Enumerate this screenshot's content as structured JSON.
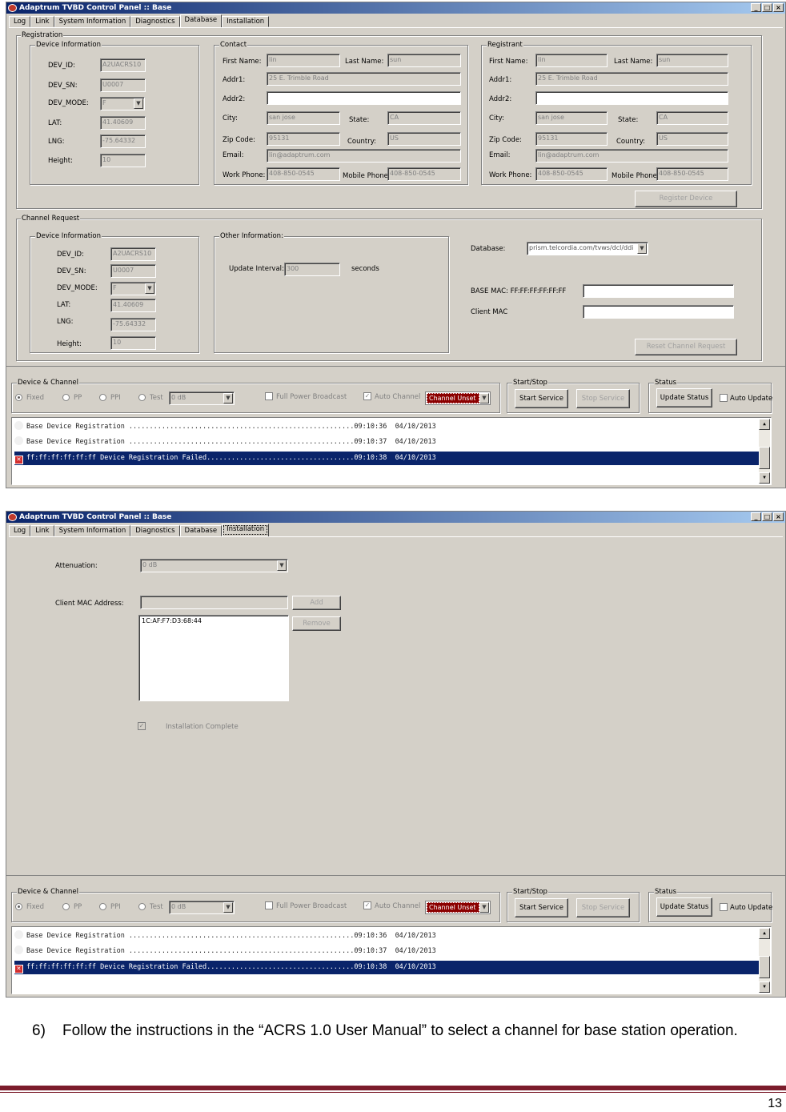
{
  "window1": {
    "title": "Adaptrum TVBD Control Panel :: Base",
    "tabs": [
      "Log",
      "Link",
      "System Information",
      "Diagnostics",
      "Database",
      "Installation"
    ],
    "active_tab": "Database"
  },
  "window2": {
    "title": "Adaptrum TVBD Control Panel :: Base",
    "tabs": [
      "Log",
      "Link",
      "System Information",
      "Diagnostics",
      "Database",
      "Installation"
    ],
    "active_tab": "Installation"
  },
  "registration": {
    "legend": "Registration",
    "device_info": {
      "legend": "Device Information",
      "dev_id_label": "DEV_ID:",
      "dev_id": "A2UACRS10",
      "dev_sn_label": "DEV_SN:",
      "dev_sn": "U0007",
      "dev_mode_label": "DEV_MODE:",
      "dev_mode": "F",
      "lat_label": "LAT:",
      "lat": "41.40609",
      "lng_label": "LNG:",
      "lng": "-75.64332",
      "height_label": "Height:",
      "height": "10"
    },
    "contact": {
      "legend": "Contact",
      "first_name_label": "First Name:",
      "first_name": "lin",
      "last_name_label": "Last Name:",
      "last_name": "sun",
      "addr1_label": "Addr1:",
      "addr1": "25 E. Trimble Road",
      "addr2_label": "Addr2:",
      "addr2": "",
      "city_label": "City:",
      "city": "san jose",
      "state_label": "State:",
      "state": "CA",
      "zip_label": "Zip Code:",
      "zip": "95131",
      "country_label": "Country:",
      "country": "US",
      "email_label": "Email:",
      "email": "lin@adaptrum.com",
      "work_phone_label": "Work Phone:",
      "work_phone": "408-850-0545",
      "mobile_phone_label": "Mobile Phone:",
      "mobile_phone": "408-850-0545"
    },
    "registrant": {
      "legend": "Registrant",
      "first_name_label": "First Name:",
      "first_name": "lin",
      "last_name_label": "Last Name:",
      "last_name": "sun",
      "addr1_label": "Addr1:",
      "addr1": "25 E. Trimble Road",
      "addr2_label": "Addr2:",
      "addr2": "",
      "city_label": "City:",
      "city": "san jose",
      "state_label": "State:",
      "state": "CA",
      "zip_label": "Zip Code:",
      "zip": "95131",
      "country_label": "Country:",
      "country": "US",
      "email_label": "Email:",
      "email": "lin@adaptrum.com",
      "work_phone_label": "Work Phone:",
      "work_phone": "408-850-0545",
      "mobile_phone_label": "Mobile Phone",
      "mobile_phone": "408-850-0545"
    },
    "register_button": "Register Device"
  },
  "channel_request": {
    "legend": "Channel Request",
    "device_info": {
      "legend": "Device Information",
      "dev_id_label": "DEV_ID:",
      "dev_id": "A2UACRS10",
      "dev_sn_label": "DEV_SN:",
      "dev_sn": "U0007",
      "dev_mode_label": "DEV_MODE:",
      "dev_mode": "F",
      "lat_label": "LAT:",
      "lat": "41.40609",
      "lng_label": "LNG:",
      "lng": "-75.64332",
      "height_label": "Height:",
      "height": "10"
    },
    "other_info": {
      "legend": "Other Information:",
      "update_interval_label": "Update Interval:",
      "update_interval": "300",
      "seconds_label": "seconds"
    },
    "database_label": "Database:",
    "database": "prism.telcordia.com/tvws/dcl/ddi",
    "base_mac_label": "BASE MAC: FF:FF:FF:FF:FF:FF",
    "base_mac": "",
    "client_mac_label": "Client MAC",
    "client_mac": "",
    "reset_button": "Reset Channel Request"
  },
  "installation": {
    "attenuation_label": "Attenuation:",
    "attenuation": "0 dB",
    "client_mac_label": "Client MAC Address:",
    "client_mac_input": "",
    "add_button": "Add",
    "remove_button": "Remove",
    "client_list": [
      "1C:AF:F7:D3:68:44"
    ],
    "complete_label": "Installation Complete"
  },
  "bottom": {
    "device_channel_legend": "Device & Channel",
    "radio_fixed": "Fixed",
    "radio_pp": "PP",
    "radio_ppi": "PPI",
    "radio_test": "Test",
    "test_value": "0 dB",
    "full_power_label": "Full Power Broadcast",
    "auto_channel_label": "Auto Channel",
    "channel_value": "Channel Unset",
    "startstop_legend": "Start/Stop",
    "start_button": "Start Service",
    "stop_button": "Stop Service",
    "status_legend": "Status",
    "update_status_button": "Update Status",
    "auto_update_label": "Auto Update"
  },
  "log": [
    {
      "text": "Base Device Registration .......................................................09:10:36  04/10/2013",
      "status": "ok"
    },
    {
      "text": "Base Device Registration .......................................................09:10:37  04/10/2013",
      "status": "ok"
    },
    {
      "text": "ff:ff:ff:ff:ff:ff Device Registration Failed....................................09:10:38  04/10/2013",
      "status": "error"
    }
  ],
  "document": {
    "step_number": "6)",
    "step_text": "Follow the instructions in the “ACRS 1.0 User Manual” to select a channel for base station operation.",
    "page_number": "13"
  },
  "colors": {
    "accent": "#0a246a",
    "footer_rule": "#7b1c2b",
    "channel_unset": "#8b0000",
    "error_icon": "#d32f2f"
  },
  "icons": {
    "app": "adaptrum-logo-icon",
    "error": "error-x-icon"
  }
}
